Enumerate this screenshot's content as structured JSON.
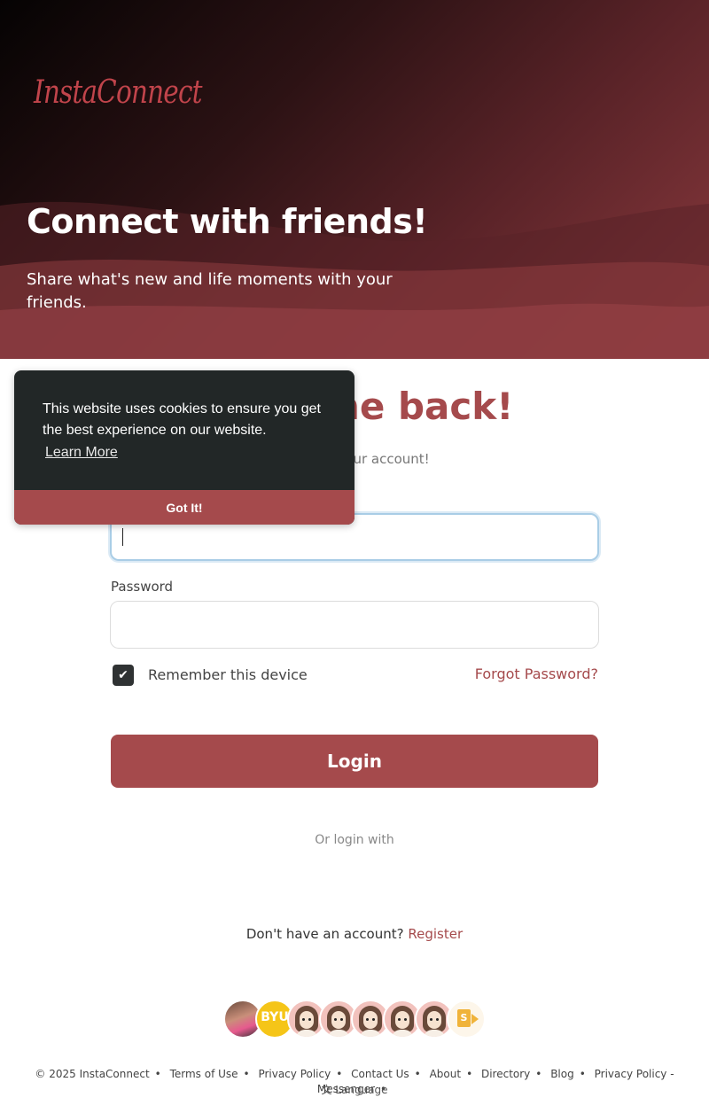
{
  "brand": {
    "logo_text": "InstaConnect",
    "accent_color": "#a54a4c"
  },
  "hero": {
    "title": "Connect with friends!",
    "subtitle": "Share what's new and life moments with your friends."
  },
  "login": {
    "title": "Welcome back!",
    "subtitle": "Login to your account!",
    "email_value": "",
    "password_label": "Password",
    "password_value": "",
    "remember_label": "Remember this device",
    "remember_checked": true,
    "forgot_label": "Forgot Password?",
    "login_button": "Login",
    "or_login_with": "Or login with",
    "no_account_text": "Don't have an account?",
    "register_link": "Register"
  },
  "avatars": [
    {
      "name": "user-photo",
      "icon": "avatar-photo"
    },
    {
      "name": "byu",
      "text": "BYU"
    },
    {
      "name": "bitmoji-1",
      "icon": "avatar-cartoon"
    },
    {
      "name": "bitmoji-2",
      "icon": "avatar-cartoon"
    },
    {
      "name": "bitmoji-3",
      "icon": "avatar-cartoon"
    },
    {
      "name": "bitmoji-4",
      "icon": "avatar-cartoon"
    },
    {
      "name": "bitmoji-5",
      "icon": "avatar-cartoon"
    },
    {
      "name": "sharepoint",
      "text": "S",
      "icon": "sharepoint-icon"
    }
  ],
  "footer": {
    "copyright": "© 2025 InstaConnect",
    "links": [
      "Terms of Use",
      "Privacy Policy",
      "Contact Us",
      "About",
      "Directory",
      "Blog",
      "Privacy Policy - Messenger"
    ],
    "language_label": "Language",
    "language_icon": "translate-icon"
  },
  "cookie_banner": {
    "message": "This website uses cookies to ensure you get the best experience on our website.",
    "learn_more": "Learn More",
    "accept_button": "Got It!",
    "background_color": "#222727"
  }
}
